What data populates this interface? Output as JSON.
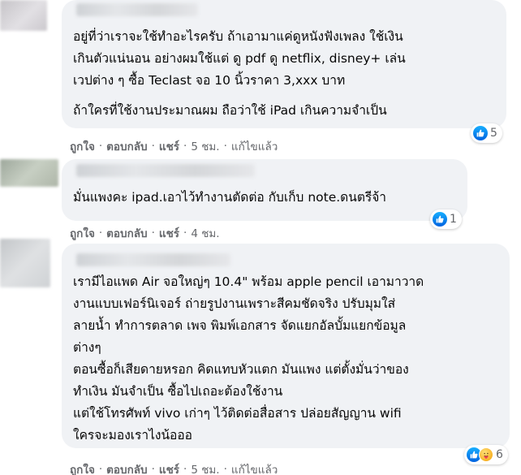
{
  "comments": [
    {
      "lines": [
        "อยู่ที่ว่าเราจะใช้ทำอะไรครับ ถ้าเอามาแค่ดูหนังฟังเพลง ใช้เงิน",
        "เกินตัวแน่นอน อย่างผมใช้แต่ ดู pdf ดู netflix, disney+ เล่น",
        "เวปต่าง ๆ ซื้อ Teclast จอ 10 นิ้วราคา 3,xxx บาท"
      ],
      "lines2": [
        "ถ้าใครที่ใช้งานประมาณผม ถือว่าใช้ iPad เกินความจำเป็น"
      ],
      "reactions": {
        "count": "5",
        "icons": [
          "like-icon"
        ]
      },
      "actions": {
        "like": "ถูกใจ",
        "reply": "ตอบกลับ",
        "share": "แชร์",
        "time": "5 ชม.",
        "edited": "แก้ไขแล้ว"
      }
    },
    {
      "lines": [
        "มั่นแพงคะ ipad.เอาไว้ทำงานตัดต่อ กับเก็บ note.ดนตรีจ้า"
      ],
      "reactions": {
        "count": "1",
        "icons": [
          "like-icon"
        ]
      },
      "actions": {
        "like": "ถูกใจ",
        "reply": "ตอบกลับ",
        "share": "แชร์",
        "time": "4 ชม."
      }
    },
    {
      "lines": [
        "เรามีไอแพด Air จอใหญ่ๆ 10.4\" พร้อม apple pencil เอามาวาด",
        "งานแบบเฟอร์นิเจอร์ ถ่ายรูปงานเพราะสีคมชัดจริง ปรับมุมใส่",
        "ลายน้ำ ทำการตลาด เพจ พิมพ์เอกสาร จัดแยกอัลบั้มแยกข้อมูล",
        "ต่างๆ",
        "ตอนซื้อก็เสียดายหรอก คิดแทบหัวแตก มันแพง แต่ตั้งมั่นว่าของ",
        "ทำเงิน มันจำเป็น ซื้อไปเถอะต้องใช้งาน",
        "แต่ใช้โทรศัพท์ vivo เก่าๆ ไว้ติดต่อสื่อสาร ปล่อยสัญญาน wifi",
        "ใครจะมองเราไงน้อออ"
      ],
      "reactions": {
        "count": "6",
        "icons": [
          "like-icon",
          "care-icon"
        ]
      },
      "actions": {
        "like": "ถูกใจ",
        "reply": "ตอบกลับ",
        "share": "แชร์",
        "time": "5 ชม.",
        "edited": "แก้ไขแล้ว"
      }
    }
  ],
  "colors": {
    "bubble": "#f0f2f5",
    "meta": "#65676b",
    "like": "#1877f2",
    "text": "#050505"
  }
}
